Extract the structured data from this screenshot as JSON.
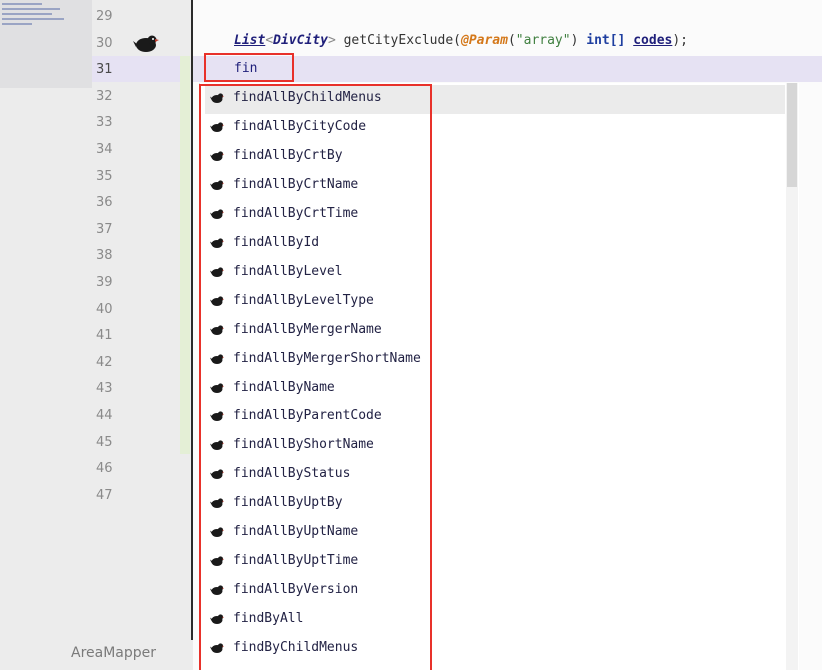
{
  "gutter": {
    "line_numbers": [
      "29",
      "30",
      "31",
      "32",
      "33",
      "34",
      "35",
      "36",
      "37",
      "38",
      "39",
      "40",
      "41",
      "42",
      "43",
      "44",
      "45",
      "46",
      "47"
    ],
    "current_line": "31",
    "file_name": "AreaMapper",
    "gutter_icon": "mybatis-bird-icon"
  },
  "editor": {
    "code": {
      "return_type": "List",
      "generic_open": "<",
      "generic_type": "DivCity",
      "generic_close": ">",
      "method_name": " getCityExclude(",
      "annotation": "@Param",
      "paren_open": "(",
      "string_literal": "\"array\"",
      "paren_close": ") ",
      "param_type": "int[]",
      "space": " ",
      "param_name": "codes",
      "tail": ");"
    },
    "typed_text": "fin"
  },
  "completion": {
    "items": [
      "findAllByChildMenus",
      "findAllByCityCode",
      "findAllByCrtBy",
      "findAllByCrtName",
      "findAllByCrtTime",
      "findAllById",
      "findAllByLevel",
      "findAllByLevelType",
      "findAllByMergerName",
      "findAllByMergerShortName",
      "findAllByName",
      "findAllByParentCode",
      "findAllByShortName",
      "findAllByStatus",
      "findAllByUptBy",
      "findAllByUptName",
      "findAllByUptTime",
      "findAllByVersion",
      "findByAll",
      "findByChildMenus"
    ],
    "selected_index": 0,
    "item_icon": "mybatis-bird-icon"
  },
  "colors": {
    "highlight_box": "#e8312a",
    "current_line": "#e6e2f3"
  }
}
